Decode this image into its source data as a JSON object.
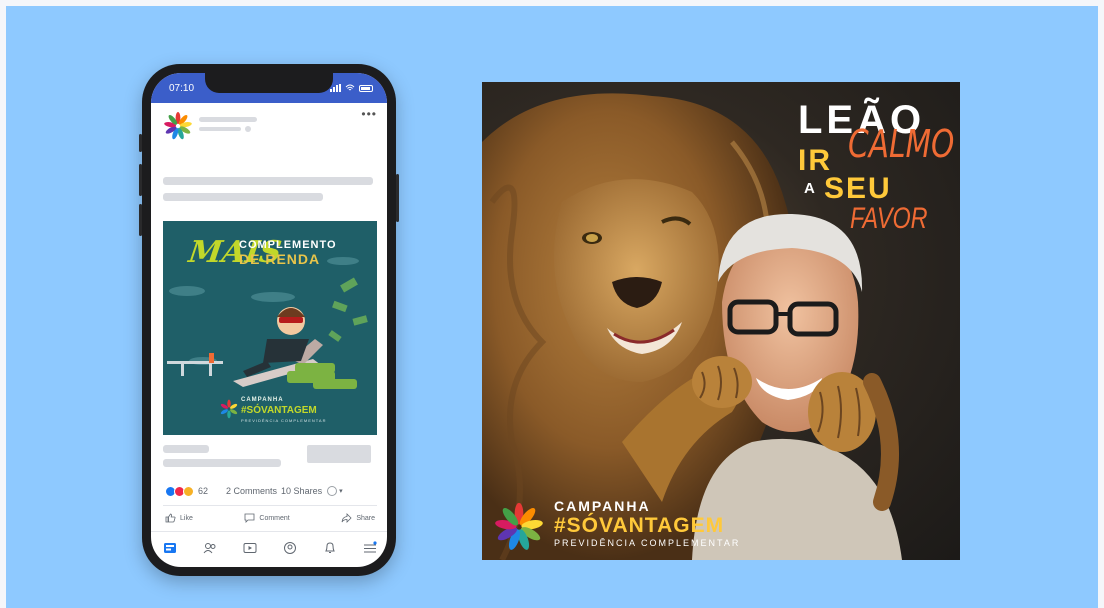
{
  "phone": {
    "status_time": "07:10",
    "post_menu": "•••",
    "ad": {
      "title_mais": "MAIS",
      "title_line1": "COMPLEMENTO",
      "title_line2": "DE RENDA",
      "brand_line1": "CAMPANHA",
      "brand_line2": "#SÓVANTAGEM",
      "brand_line3": "PREVIDÊNCIA COMPLEMENTAR"
    },
    "reactions_count": "62",
    "comments": "2 Comments",
    "shares": "10 Shares",
    "actions": {
      "like": "Like",
      "comment": "Comment",
      "share": "Share"
    }
  },
  "poster": {
    "headline": {
      "leao": "LEÃO",
      "calmo": "CALMO",
      "ir": "IR",
      "a": "A",
      "seu": "SEU",
      "favor": "FAVOR"
    },
    "brand_line1": "CAMPANHA",
    "brand_line2": "#SÓVANTAGEM",
    "brand_line3": "PREVIDÊNCIA COMPLEMENTAR"
  },
  "colors": {
    "background": "#8ec9ff",
    "facebook_blue": "#3b5ec9",
    "ad_teal": "#1f5f68",
    "accent_yellow": "#ffc93a",
    "accent_orange": "#ef6b34",
    "accent_lime": "#c2d82a"
  }
}
